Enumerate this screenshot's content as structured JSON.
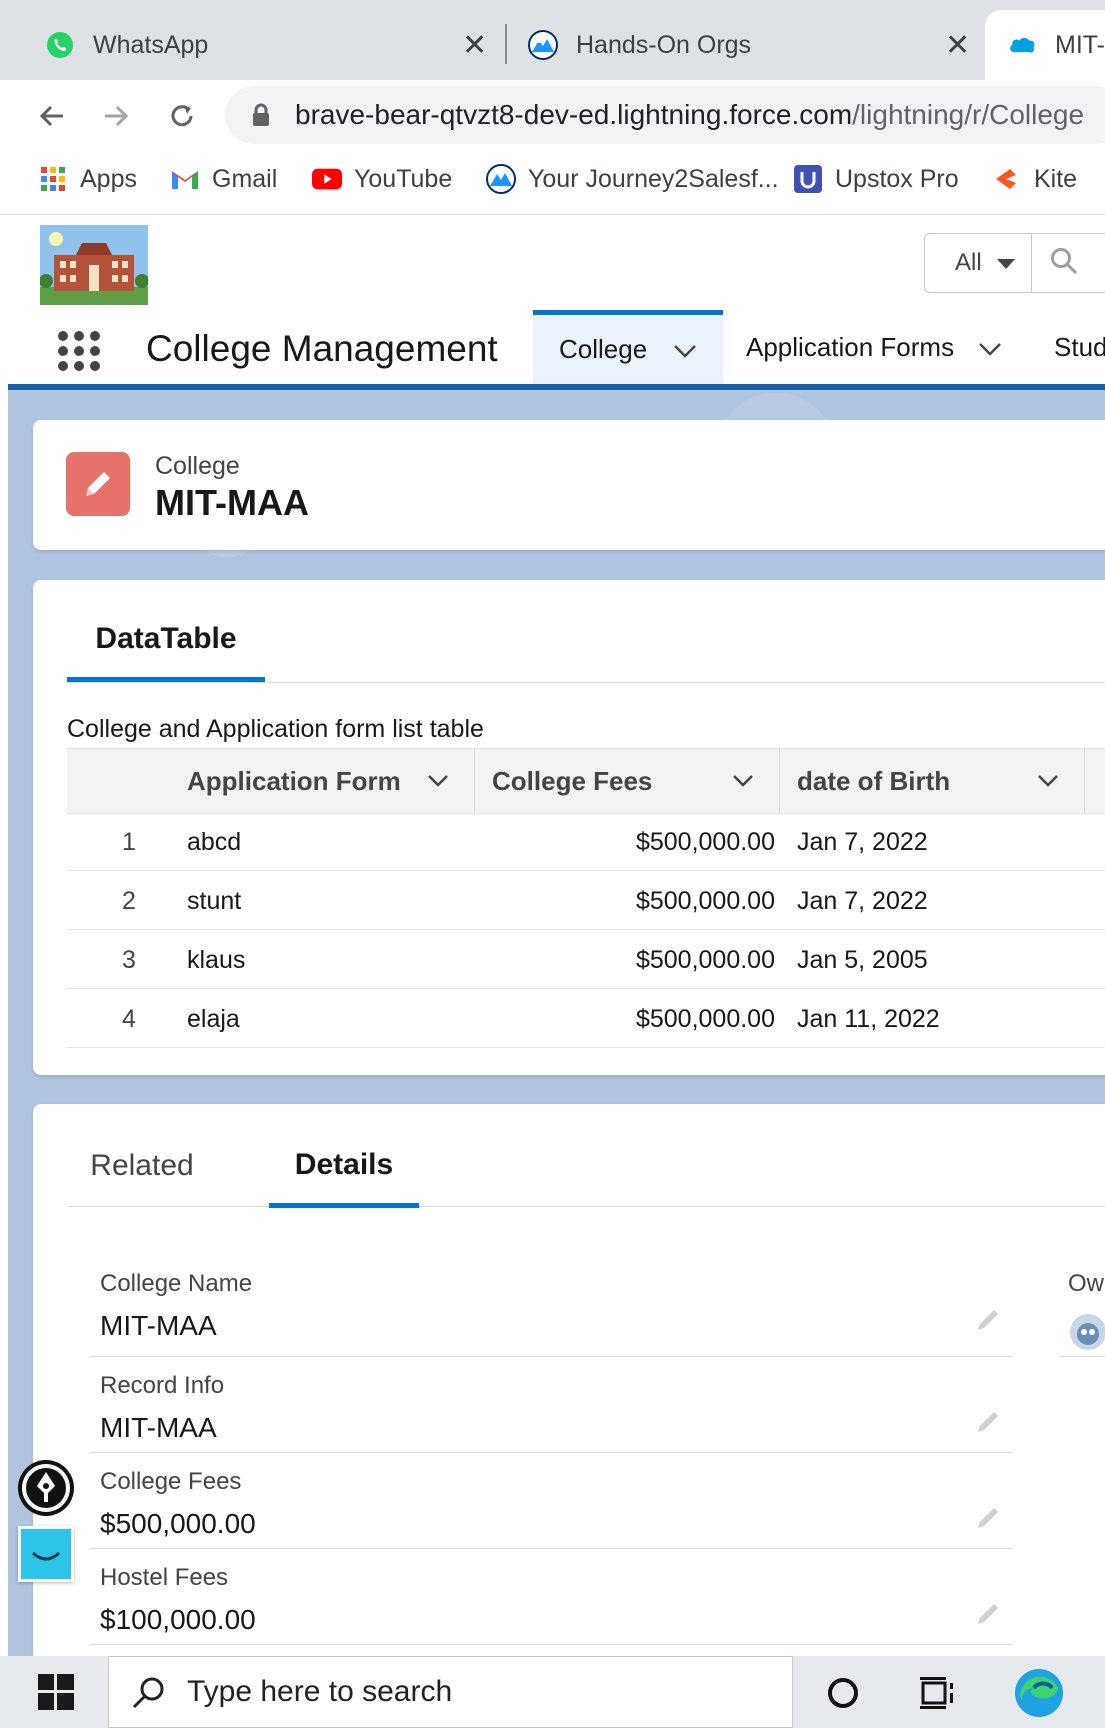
{
  "browser": {
    "tabs": [
      {
        "title": "WhatsApp",
        "icon": "whatsapp-icon"
      },
      {
        "title": "Hands-On Orgs",
        "icon": "trailhead-icon"
      },
      {
        "title": "MIT-",
        "icon": "salesforce-cloud-icon"
      }
    ],
    "close_glyph": "✕",
    "url_host": "brave-bear-qtvzt8-dev-ed.lightning.force.com",
    "url_path": "/lightning/r/College",
    "bookmarks": [
      {
        "label": "Apps",
        "icon": "apps-grid-icon"
      },
      {
        "label": "Gmail",
        "icon": "gmail-icon"
      },
      {
        "label": "YouTube",
        "icon": "youtube-icon"
      },
      {
        "label": "Your Journey2Salesf...",
        "icon": "trailhead-icon"
      },
      {
        "label": "Upstox Pro",
        "icon": "upstox-icon"
      },
      {
        "label": "Kite",
        "icon": "kite-icon"
      }
    ]
  },
  "sf": {
    "search_scope": "All",
    "app_name": "College Management",
    "nav_tabs": [
      {
        "label": "College",
        "active": true
      },
      {
        "label": "Application Forms",
        "active": false
      },
      {
        "label": "Stud",
        "active": false
      }
    ],
    "record": {
      "object_label": "College",
      "name": "MIT-MAA"
    },
    "datatable_card": {
      "tab_label": "DataTable",
      "caption": "College and Application form list table",
      "columns": [
        "Application Form",
        "College Fees",
        "date of Birth"
      ],
      "rows": [
        {
          "num": "1",
          "form": "abcd",
          "fees": "$500,000.00",
          "dob": "Jan 7, 2022"
        },
        {
          "num": "2",
          "form": "stunt",
          "fees": "$500,000.00",
          "dob": "Jan 7, 2022"
        },
        {
          "num": "3",
          "form": "klaus",
          "fees": "$500,000.00",
          "dob": "Jan 5, 2005"
        },
        {
          "num": "4",
          "form": "elaja",
          "fees": "$500,000.00",
          "dob": "Jan 11, 2022"
        }
      ]
    },
    "details_card": {
      "tabs": [
        "Related",
        "Details"
      ],
      "active_tab": "Details",
      "fields": [
        {
          "label": "College Name",
          "value": "MIT-MAA"
        },
        {
          "label": "Record Info",
          "value": "MIT-MAA"
        },
        {
          "label": "College Fees",
          "value": "$500,000.00"
        },
        {
          "label": "Hostel Fees",
          "value": "$100,000.00"
        }
      ],
      "owner_label": "Ow"
    }
  },
  "taskbar": {
    "search_placeholder": "Type here to search"
  },
  "colors": {
    "brand_blue": "#0176d3",
    "nav_bar_blue": "#1b5f9e",
    "record_icon": "#e5736a",
    "page_bg": "#b0c4df"
  }
}
